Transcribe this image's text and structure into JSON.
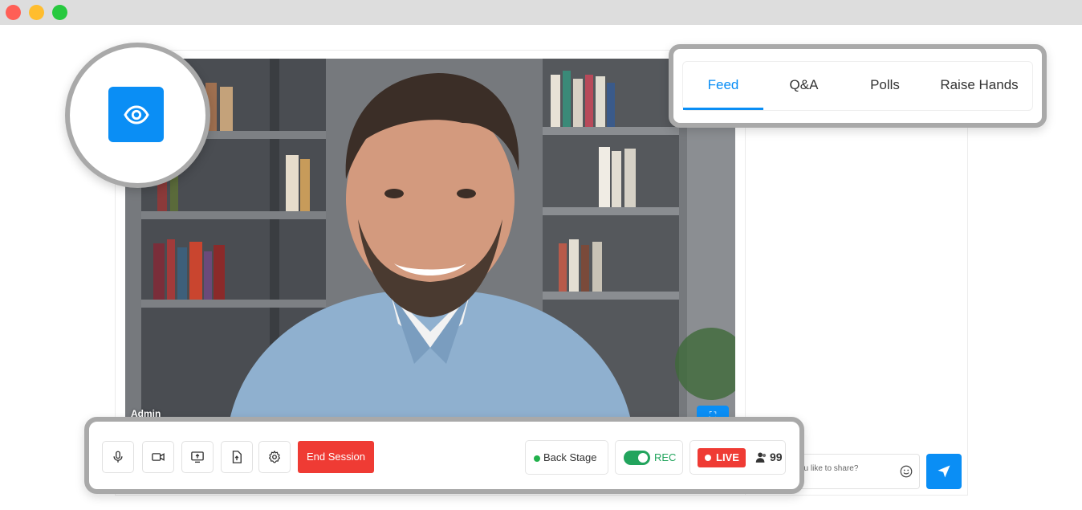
{
  "window": {
    "controls": [
      "close",
      "minimize",
      "maximize"
    ]
  },
  "video": {
    "participant_label": "Admin",
    "fullscreen_icon": "expand-icon"
  },
  "eye_button": {
    "icon": "eye-icon"
  },
  "tabs": [
    {
      "label": "Feed",
      "active": true
    },
    {
      "label": "Q&A",
      "active": false
    },
    {
      "label": "Polls",
      "active": false
    },
    {
      "label": "Raise Hands",
      "active": false
    }
  ],
  "chat": {
    "placeholder": "ou like to share?",
    "emoji_icon": "smile-icon",
    "send_icon": "send-icon"
  },
  "toolbar": {
    "buttons": [
      "microphone-icon",
      "camera-icon",
      "screen-share-icon",
      "file-upload-icon",
      "settings-icon"
    ],
    "end_session_label": "End Session",
    "back_stage_label": "Back Stage",
    "rec_label": "REC",
    "rec_enabled": true,
    "live_label": "LIVE",
    "viewer_count": "99"
  },
  "colors": {
    "accent": "#0a8ef5",
    "danger": "#ef3b34",
    "success": "#22a45d",
    "highlight_ring": "#a9a9a9"
  }
}
